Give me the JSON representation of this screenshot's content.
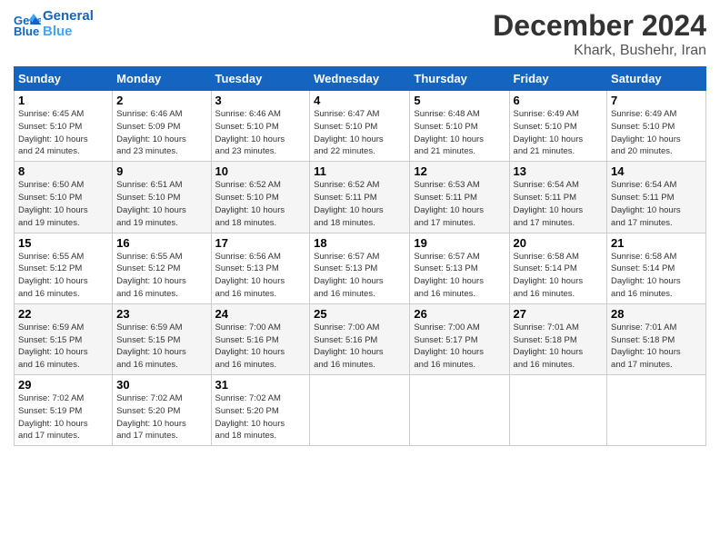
{
  "header": {
    "logo_line1": "General",
    "logo_line2": "Blue",
    "month_title": "December 2024",
    "location": "Khark, Bushehr, Iran"
  },
  "weekdays": [
    "Sunday",
    "Monday",
    "Tuesday",
    "Wednesday",
    "Thursday",
    "Friday",
    "Saturday"
  ],
  "weeks": [
    [
      {
        "day": "1",
        "info": "Sunrise: 6:45 AM\nSunset: 5:10 PM\nDaylight: 10 hours\nand 24 minutes."
      },
      {
        "day": "2",
        "info": "Sunrise: 6:46 AM\nSunset: 5:09 PM\nDaylight: 10 hours\nand 23 minutes."
      },
      {
        "day": "3",
        "info": "Sunrise: 6:46 AM\nSunset: 5:10 PM\nDaylight: 10 hours\nand 23 minutes."
      },
      {
        "day": "4",
        "info": "Sunrise: 6:47 AM\nSunset: 5:10 PM\nDaylight: 10 hours\nand 22 minutes."
      },
      {
        "day": "5",
        "info": "Sunrise: 6:48 AM\nSunset: 5:10 PM\nDaylight: 10 hours\nand 21 minutes."
      },
      {
        "day": "6",
        "info": "Sunrise: 6:49 AM\nSunset: 5:10 PM\nDaylight: 10 hours\nand 21 minutes."
      },
      {
        "day": "7",
        "info": "Sunrise: 6:49 AM\nSunset: 5:10 PM\nDaylight: 10 hours\nand 20 minutes."
      }
    ],
    [
      {
        "day": "8",
        "info": "Sunrise: 6:50 AM\nSunset: 5:10 PM\nDaylight: 10 hours\nand 19 minutes."
      },
      {
        "day": "9",
        "info": "Sunrise: 6:51 AM\nSunset: 5:10 PM\nDaylight: 10 hours\nand 19 minutes."
      },
      {
        "day": "10",
        "info": "Sunrise: 6:52 AM\nSunset: 5:10 PM\nDaylight: 10 hours\nand 18 minutes."
      },
      {
        "day": "11",
        "info": "Sunrise: 6:52 AM\nSunset: 5:11 PM\nDaylight: 10 hours\nand 18 minutes."
      },
      {
        "day": "12",
        "info": "Sunrise: 6:53 AM\nSunset: 5:11 PM\nDaylight: 10 hours\nand 17 minutes."
      },
      {
        "day": "13",
        "info": "Sunrise: 6:54 AM\nSunset: 5:11 PM\nDaylight: 10 hours\nand 17 minutes."
      },
      {
        "day": "14",
        "info": "Sunrise: 6:54 AM\nSunset: 5:11 PM\nDaylight: 10 hours\nand 17 minutes."
      }
    ],
    [
      {
        "day": "15",
        "info": "Sunrise: 6:55 AM\nSunset: 5:12 PM\nDaylight: 10 hours\nand 16 minutes."
      },
      {
        "day": "16",
        "info": "Sunrise: 6:55 AM\nSunset: 5:12 PM\nDaylight: 10 hours\nand 16 minutes."
      },
      {
        "day": "17",
        "info": "Sunrise: 6:56 AM\nSunset: 5:13 PM\nDaylight: 10 hours\nand 16 minutes."
      },
      {
        "day": "18",
        "info": "Sunrise: 6:57 AM\nSunset: 5:13 PM\nDaylight: 10 hours\nand 16 minutes."
      },
      {
        "day": "19",
        "info": "Sunrise: 6:57 AM\nSunset: 5:13 PM\nDaylight: 10 hours\nand 16 minutes."
      },
      {
        "day": "20",
        "info": "Sunrise: 6:58 AM\nSunset: 5:14 PM\nDaylight: 10 hours\nand 16 minutes."
      },
      {
        "day": "21",
        "info": "Sunrise: 6:58 AM\nSunset: 5:14 PM\nDaylight: 10 hours\nand 16 minutes."
      }
    ],
    [
      {
        "day": "22",
        "info": "Sunrise: 6:59 AM\nSunset: 5:15 PM\nDaylight: 10 hours\nand 16 minutes."
      },
      {
        "day": "23",
        "info": "Sunrise: 6:59 AM\nSunset: 5:15 PM\nDaylight: 10 hours\nand 16 minutes."
      },
      {
        "day": "24",
        "info": "Sunrise: 7:00 AM\nSunset: 5:16 PM\nDaylight: 10 hours\nand 16 minutes."
      },
      {
        "day": "25",
        "info": "Sunrise: 7:00 AM\nSunset: 5:16 PM\nDaylight: 10 hours\nand 16 minutes."
      },
      {
        "day": "26",
        "info": "Sunrise: 7:00 AM\nSunset: 5:17 PM\nDaylight: 10 hours\nand 16 minutes."
      },
      {
        "day": "27",
        "info": "Sunrise: 7:01 AM\nSunset: 5:18 PM\nDaylight: 10 hours\nand 16 minutes."
      },
      {
        "day": "28",
        "info": "Sunrise: 7:01 AM\nSunset: 5:18 PM\nDaylight: 10 hours\nand 17 minutes."
      }
    ],
    [
      {
        "day": "29",
        "info": "Sunrise: 7:02 AM\nSunset: 5:19 PM\nDaylight: 10 hours\nand 17 minutes."
      },
      {
        "day": "30",
        "info": "Sunrise: 7:02 AM\nSunset: 5:20 PM\nDaylight: 10 hours\nand 17 minutes."
      },
      {
        "day": "31",
        "info": "Sunrise: 7:02 AM\nSunset: 5:20 PM\nDaylight: 10 hours\nand 18 minutes."
      },
      {
        "day": "",
        "info": ""
      },
      {
        "day": "",
        "info": ""
      },
      {
        "day": "",
        "info": ""
      },
      {
        "day": "",
        "info": ""
      }
    ]
  ]
}
